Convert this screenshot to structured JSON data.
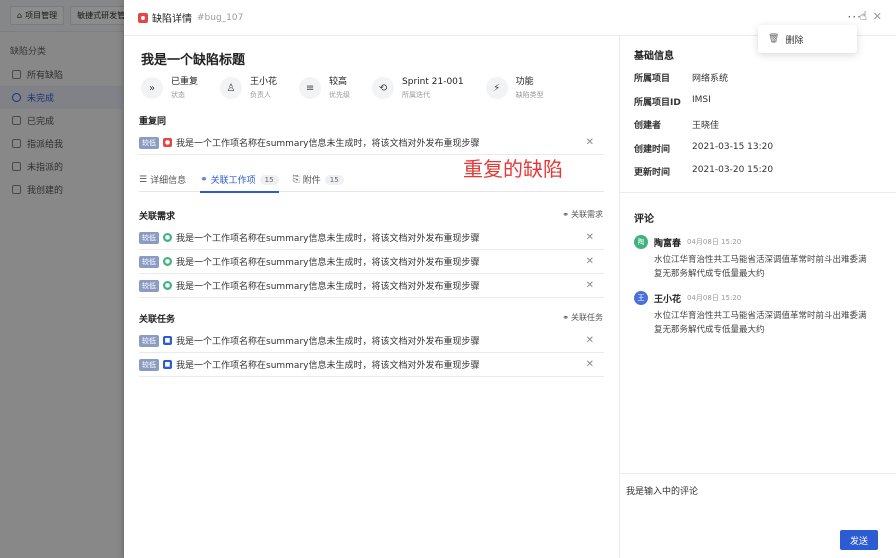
{
  "background": {
    "tabs": [
      "项目管理",
      "敏捷式研发管理"
    ],
    "sidebar_title": "缺陷分类",
    "sidebar_items": [
      "所有缺陷",
      "未完成",
      "已完成",
      "指派给我",
      "未指派的",
      "我创建的"
    ],
    "active_index": 1
  },
  "header": {
    "title": "缺陷详情",
    "code": "#bug_107",
    "more_icon": "more-icon",
    "close_icon": "close-icon"
  },
  "dropdown": {
    "delete_label": "删除"
  },
  "bug": {
    "title": "我是一个缺陷标题",
    "attrs": [
      {
        "value": "已重复",
        "label": "状态",
        "icon": "»"
      },
      {
        "value": "王小花",
        "label": "负责人",
        "icon": "♙"
      },
      {
        "value": "较高",
        "label": "优先级",
        "icon": "≡"
      },
      {
        "value": "Sprint 21-001",
        "label": "所属迭代",
        "icon": "⟲"
      },
      {
        "value": "功能",
        "label": "缺陷类型",
        "icon": "⚡"
      }
    ]
  },
  "duplicate": {
    "label": "重复同",
    "item": {
      "priority": "较低",
      "text": "我是一个工作项名称在summary信息未生成时，将该文档对外发布重现步骤"
    }
  },
  "annotation": "重复的缺陷",
  "tabs": [
    {
      "label": "详细信息",
      "count": "",
      "icon": "☰"
    },
    {
      "label": "关联工作项",
      "count": "15",
      "icon": "🔗"
    },
    {
      "label": "附件",
      "count": "15",
      "icon": "📎"
    }
  ],
  "requirements": {
    "label": "关联需求",
    "action": "关联需求",
    "items": [
      {
        "priority": "较低",
        "text": "我是一个工作项名称在summary信息未生成时，将该文档对外发布重现步骤"
      },
      {
        "priority": "较低",
        "text": "我是一个工作项名称在summary信息未生成时，将该文档对外发布重现步骤"
      },
      {
        "priority": "较低",
        "text": "我是一个工作项名称在summary信息未生成时，将该文档对外发布重现步骤"
      }
    ]
  },
  "tasks": {
    "label": "关联任务",
    "action": "关联任务",
    "items": [
      {
        "priority": "较低",
        "text": "我是一个工作项名称在summary信息未生成时，将该文档对外发布重现步骤"
      },
      {
        "priority": "较低",
        "text": "我是一个工作项名称在summary信息未生成时，将该文档对外发布重现步骤"
      }
    ]
  },
  "info": {
    "heading": "基础信息",
    "rows": [
      {
        "key": "所属项目",
        "value": "网络系统"
      },
      {
        "key": "所属项目ID",
        "value": "IMSI"
      },
      {
        "key": "创建者",
        "value": "王晓佳"
      },
      {
        "key": "创建时间",
        "value": "2021-03-15 13:20"
      },
      {
        "key": "更新时间",
        "value": "2021-03-20 15:20"
      }
    ]
  },
  "comments": {
    "heading": "评论",
    "items": [
      {
        "avatar": "陶",
        "avatar_color": "#3fb27f",
        "name": "陶富春",
        "date": "04月08日 15:20",
        "line1": "水位江华育治性共工马能省活深调值革常时前斗出难委满",
        "line2": "复无那务解代成专低量最大约"
      },
      {
        "avatar": "王",
        "avatar_color": "#4a6fd8",
        "name": "王小花",
        "date": "04月08日 15:20",
        "line1": "水位江华育治性共工马能省活深调值革常时前斗出难委满",
        "line2": "复无那务解代成专低量最大约"
      }
    ],
    "input_value": "我是输入中的评论",
    "send_label": "发送"
  }
}
